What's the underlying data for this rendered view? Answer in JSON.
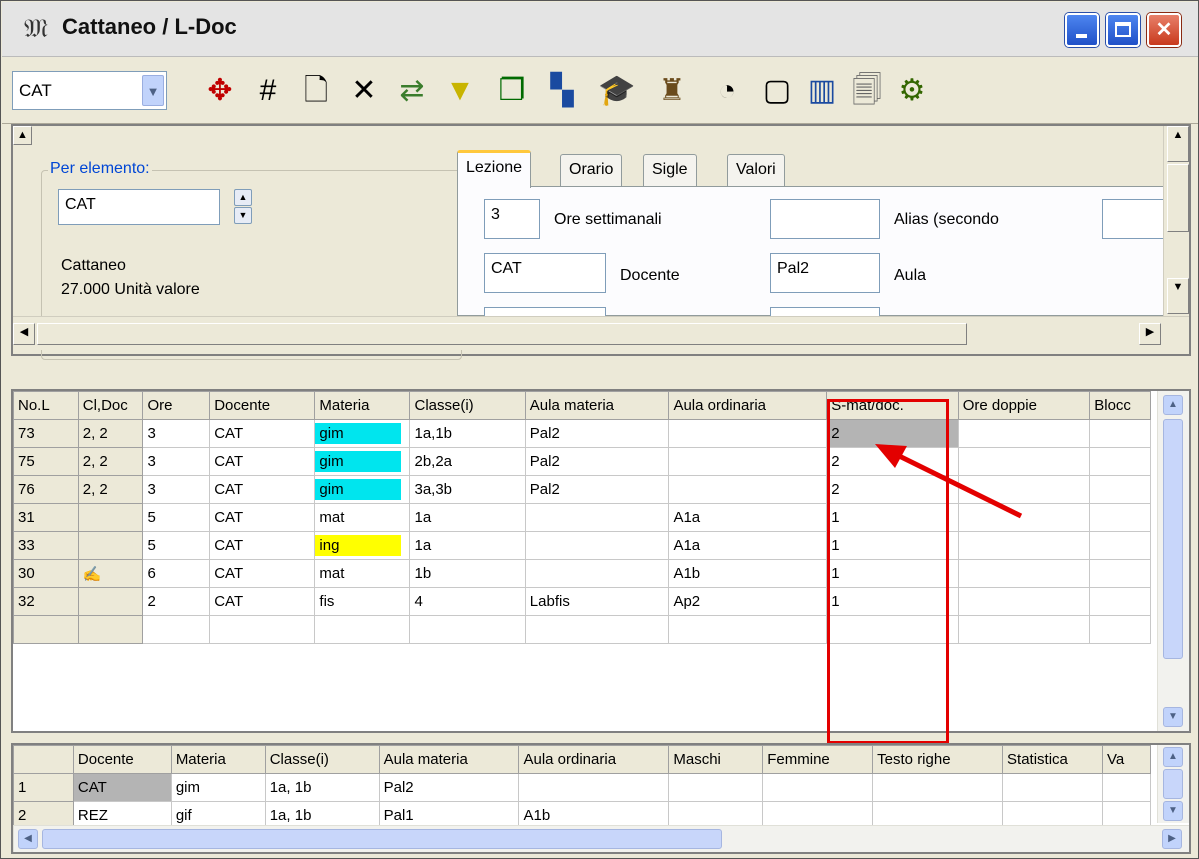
{
  "window": {
    "title": "Cattaneo / L-Doc",
    "app_icon": "pattern-glyph"
  },
  "toolbar": {
    "combo_value": "CAT",
    "buttons": [
      {
        "icon": "navigate-icon",
        "glyph": "✥",
        "color": "#c00000"
      },
      {
        "icon": "grid-icon",
        "glyph": "#",
        "color": "#000"
      },
      {
        "icon": "new-document-icon",
        "glyph": "🗋",
        "color": "#000"
      },
      {
        "icon": "delete-icon",
        "glyph": "✕",
        "color": "#000"
      },
      {
        "icon": "swap-icon",
        "glyph": "⇄",
        "color": "#3a7d2c"
      },
      {
        "icon": "filter-icon",
        "glyph": "▼",
        "color": "#c8b400"
      },
      {
        "icon": "window-icon",
        "glyph": "❐",
        "color": "#006a00"
      },
      {
        "icon": "windows-icon",
        "glyph": "▚",
        "color": "#1a4aa0"
      },
      {
        "icon": "teacher-icon",
        "glyph": "🎓",
        "color": "#000"
      },
      {
        "icon": "stamp-icon",
        "glyph": "♜",
        "color": "#6a4b1c"
      },
      {
        "icon": "clock-icon",
        "glyph": "◔",
        "color": "#000"
      },
      {
        "icon": "calendar-icon",
        "glyph": "▢",
        "color": "#000"
      },
      {
        "icon": "columns-icon",
        "glyph": "▥",
        "color": "#1a4aa0"
      },
      {
        "icon": "preview-icon",
        "glyph": "🗐",
        "color": "#666"
      },
      {
        "icon": "people-icon",
        "glyph": "⚙",
        "color": "#336600"
      }
    ]
  },
  "top_pane": {
    "group_label": "Per elemento:",
    "element_value": "CAT",
    "name": "Cattaneo",
    "value_units": "27.000 Unità valore",
    "tabs": [
      "Lezione",
      "Orario",
      "Sigle",
      "Valori"
    ],
    "fields": {
      "ore_value": "3",
      "ore_label": "Ore settimanali",
      "alias_value": "",
      "alias_label": "Alias (secondo",
      "docente_value": "CAT",
      "docente_label": "Docente",
      "aula_value": "Pal2",
      "aula_label": "Aula"
    }
  },
  "lessons_table": {
    "columns": [
      "No.L",
      "Cl,Doc",
      "Ore",
      "Docente",
      "Materia",
      "Classe(i)",
      "Aula materia",
      "Aula ordinaria",
      "S-mat/doc.",
      "Ore doppie",
      "Blocc"
    ],
    "rows": [
      [
        "73",
        "2, 2",
        "3",
        "CAT",
        "gim",
        "1a,1b",
        "Pal2",
        "",
        "2",
        "",
        ""
      ],
      [
        "75",
        "2, 2",
        "3",
        "CAT",
        "gim",
        "2b,2a",
        "Pal2",
        "",
        "2",
        "",
        ""
      ],
      [
        "76",
        "2, 2",
        "3",
        "CAT",
        "gim",
        "3a,3b",
        "Pal2",
        "",
        "2",
        "",
        ""
      ],
      [
        "31",
        "",
        "5",
        "CAT",
        "mat",
        "1a",
        "",
        "A1a",
        "1",
        "",
        ""
      ],
      [
        "33",
        "",
        "5",
        "CAT",
        "ing",
        "1a",
        "",
        "A1a",
        "1",
        "",
        ""
      ],
      [
        "30",
        "✍",
        "6",
        "CAT",
        "mat",
        "1b",
        "",
        "A1b",
        "1",
        "",
        ""
      ],
      [
        "32",
        "",
        "2",
        "CAT",
        "fis",
        "4",
        "Labfis",
        "Ap2",
        "1",
        "",
        ""
      ],
      [
        "",
        "",
        "",
        "",
        "",
        "",
        "",
        "",
        "",
        "",
        ""
      ]
    ],
    "highlight": {
      "cyan": "#00e5ee",
      "yellow": "#ffff00",
      "annotation": "#e30000"
    }
  },
  "detail_table": {
    "columns": [
      "",
      "Docente",
      "Materia",
      "Classe(i)",
      "Aula materia",
      "Aula ordinaria",
      "Maschi",
      "Femmine",
      "Testo righe",
      "Statistica",
      "Va"
    ],
    "rows": [
      [
        "1",
        "CAT",
        "gim",
        "1a, 1b",
        "Pal2",
        "",
        "",
        "",
        "",
        "",
        ""
      ],
      [
        "2",
        "REZ",
        "gif",
        "1a, 1b",
        "Pal1",
        "A1b",
        "",
        "",
        "",
        "",
        ""
      ],
      [
        "",
        "",
        "",
        "",
        "",
        "",
        "",
        "",
        "",
        "",
        ""
      ]
    ]
  }
}
